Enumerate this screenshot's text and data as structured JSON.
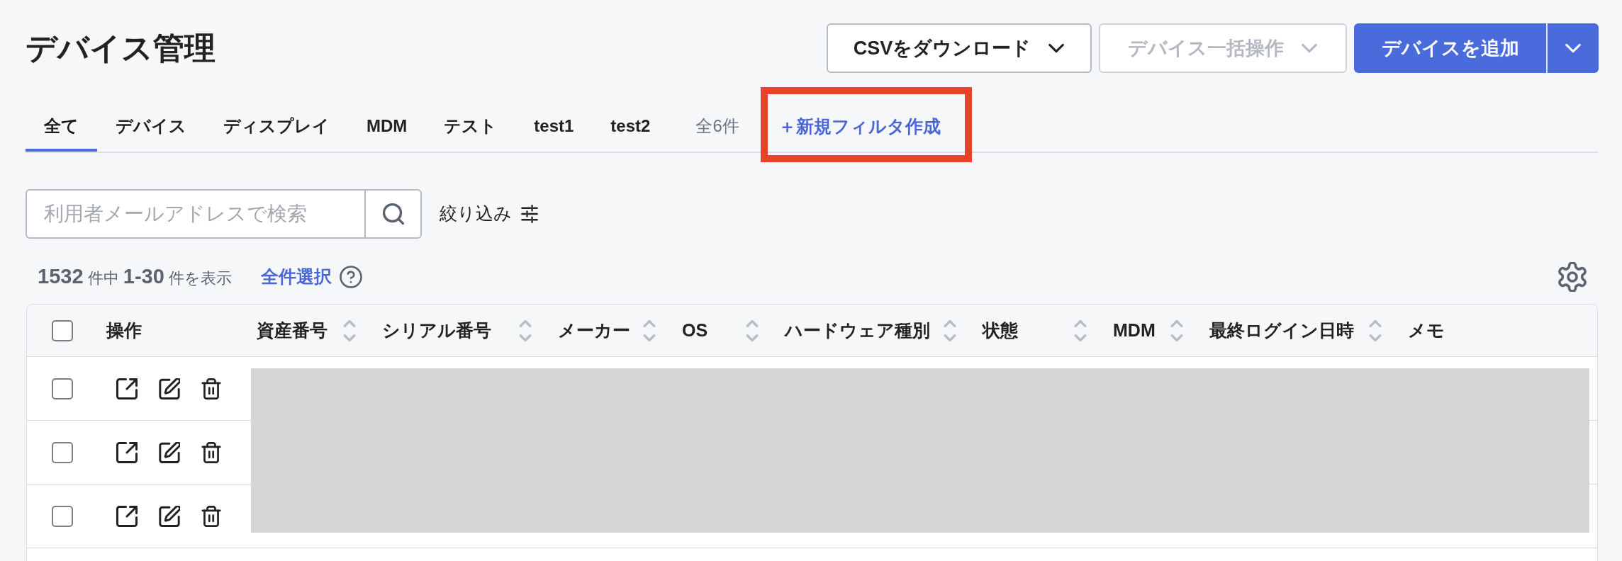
{
  "header": {
    "title": "デバイス管理",
    "actions": [
      {
        "label": "CSVをダウンロード",
        "kind": "dropdown",
        "disabled": false
      },
      {
        "label": "デバイス一括操作",
        "kind": "dropdown",
        "disabled": true
      },
      {
        "label": "デバイスを追加",
        "kind": "split",
        "disabled": false
      }
    ]
  },
  "tabs": {
    "items": [
      {
        "label": "全て",
        "selected": true
      },
      {
        "label": "デバイス",
        "selected": false
      },
      {
        "label": "ディスプレイ",
        "selected": false
      },
      {
        "label": "MDM",
        "selected": false
      },
      {
        "label": "テスト",
        "selected": false
      },
      {
        "label": "test1",
        "selected": false
      },
      {
        "label": "test2",
        "selected": false
      }
    ],
    "count": "全6件",
    "new_filter": {
      "label": "＋新規フィルタ作成",
      "highlighted": true
    }
  },
  "search": {
    "placeholder": "利用者メールアドレスで検索",
    "filter_label": "絞り込み"
  },
  "results": {
    "summary": "**1532** 件中 **1-30** 件を表示",
    "select_all": "全件選択"
  },
  "table": {
    "select_all_checked": false,
    "columns": [
      {
        "label": "操作",
        "sortable": false
      },
      {
        "label": "資産番号",
        "sortable": true
      },
      {
        "label": "シリアル番号",
        "sortable": true
      },
      {
        "label": "メーカー",
        "sortable": true
      },
      {
        "label": "OS",
        "sortable": true
      },
      {
        "label": "ハードウェア種別",
        "sortable": true
      },
      {
        "label": "状態",
        "sortable": true
      },
      {
        "label": "MDM",
        "sortable": true
      },
      {
        "label": "最終ログイン日時",
        "sortable": true
      },
      {
        "label": "メモ",
        "sortable": false
      }
    ],
    "rows": [
      {
        "checked": false
      },
      {
        "checked": false
      },
      {
        "checked": false
      }
    ],
    "redacted": true
  }
}
